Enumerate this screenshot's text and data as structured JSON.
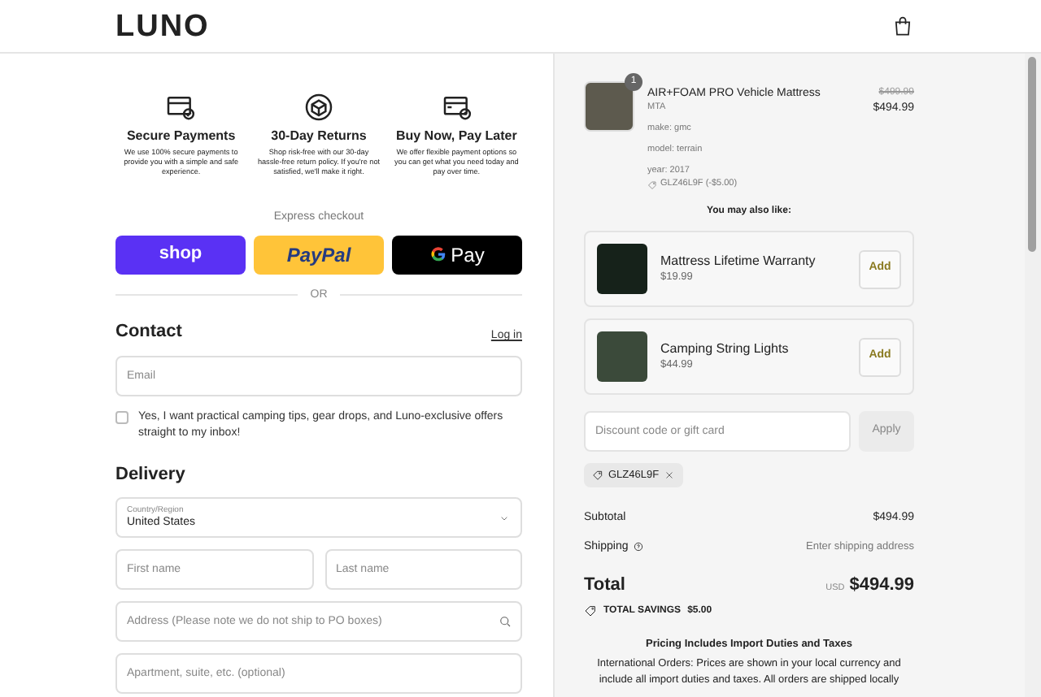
{
  "header": {
    "logo": "LUNO"
  },
  "features": [
    {
      "title": "Secure Payments",
      "text": "We use 100% secure payments to provide you with a simple and safe experience.",
      "kind": "card"
    },
    {
      "title": "30-Day Returns",
      "text": "Shop risk-free with our 30-day hassle-free return policy. If you're not satisfied, we'll make it right.",
      "kind": "box"
    },
    {
      "title": "Buy Now, Pay Later",
      "text": "We offer flexible payment options so you can get what you need today and pay over time.",
      "kind": "clock"
    }
  ],
  "express": {
    "label": "Express checkout",
    "buttons": [
      {
        "label": "shop",
        "kind": "shop"
      },
      {
        "label": "PayPal",
        "kind": "paypal"
      },
      {
        "label": "Pay",
        "kind": "gpay"
      }
    ],
    "divider": "OR"
  },
  "contact": {
    "heading": "Contact",
    "login": "Log in",
    "email_placeholder": "Email",
    "newsletter": {
      "label": "Yes, I want practical camping tips, gear drops, and Luno-exclusive offers straight to my inbox!",
      "checked": false
    }
  },
  "delivery": {
    "heading": "Delivery",
    "country_label": "Country/Region",
    "country": "United States",
    "first_name_placeholder": "First name",
    "last_name_placeholder": "Last name",
    "address_placeholder": "Address (Please note we do not ship to PO boxes)",
    "apartment_placeholder": "Apartment, suite, etc. (optional)"
  },
  "order": {
    "item": {
      "quantity": "1",
      "name": "AIR+FOAM PRO Vehicle Mattress",
      "variant": "MTA",
      "properties": [
        "make: gmc",
        "model: terrain",
        "year: 2017"
      ],
      "discount": "GLZ46L9F (-$5.00)",
      "original_price": "$499.99",
      "price": "$494.99"
    },
    "upsell_heading": "You may also like:",
    "upsells": [
      {
        "name": "Mattress Lifetime Warranty",
        "price": "$19.99",
        "button": "Add",
        "kind": "warranty"
      },
      {
        "name": "Camping String Lights",
        "price": "$44.99",
        "button": "Add",
        "kind": "lights"
      }
    ],
    "discount_placeholder": "Discount code or gift card",
    "apply": "Apply",
    "code": "GLZ46L9F",
    "subtotal_label": "Subtotal",
    "subtotal": "$494.99",
    "shipping_label": "Shipping",
    "shipping": "Enter shipping address",
    "total_label": "Total",
    "currency": "USD",
    "total": "$494.99",
    "savings_label": "TOTAL SAVINGS",
    "savings": "$5.00",
    "notice_title": "Pricing Includes Import Duties and Taxes",
    "notice_text": "International Orders: Prices are shown in your local currency and include all import duties and taxes. All orders are shipped locally"
  }
}
